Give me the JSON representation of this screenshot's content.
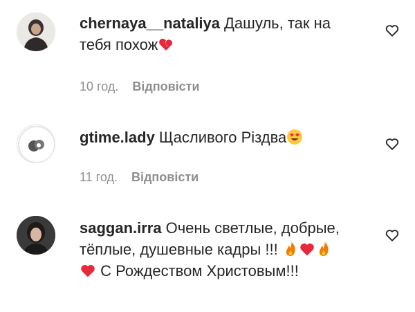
{
  "comments": [
    {
      "username": "chernaya__nataliya",
      "text_before_emoji": "Дашуль, так на тебя похож",
      "emoji": [
        "broken-heart-emoji"
      ],
      "time": "10 год.",
      "reply_label": "Відповісти"
    },
    {
      "username": "gtime.lady",
      "text_before_emoji": "Щасливого Різдва",
      "emoji": [
        "heart-eyes-emoji"
      ],
      "time": "11 год.",
      "reply_label": "Відповісти"
    },
    {
      "username": "saggan.irra",
      "text_part1": "Очень светлые, добрые, тёплые, душевные кадры !!!",
      "emoji": [
        "fire-emoji",
        "red-heart-emoji",
        "fire-emoji",
        "red-heart-emoji"
      ],
      "text_part2": "С Рождеством Христовым!!!"
    }
  ],
  "colors": {
    "text": "#262626",
    "secondary": "#8e8e8e",
    "heart_red": "#e8283b",
    "fire_orange": "#f57c00"
  }
}
